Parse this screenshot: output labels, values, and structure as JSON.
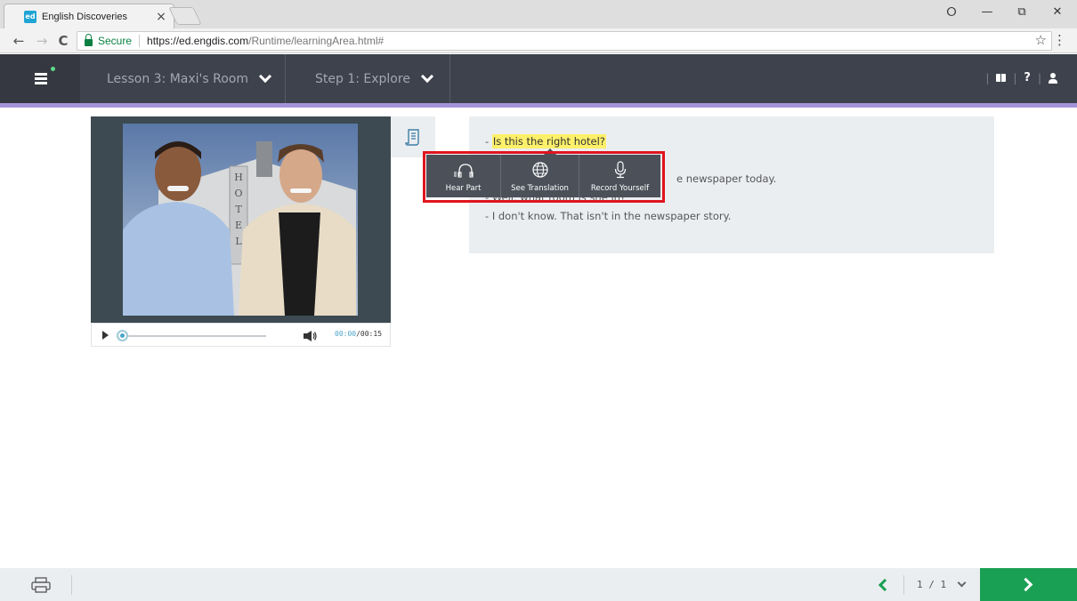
{
  "browser": {
    "tab_title": "English Discoveries",
    "tab_close": "×",
    "favicon_text": "ed",
    "secure_label": "Secure",
    "url_host": "https://ed.engdis.com",
    "url_path": "/Runtime/learningArea.html#",
    "window_controls": {
      "profile": "⭘",
      "minimize": "—",
      "restore": "⧉",
      "close": "✕"
    },
    "nav": {
      "back": "←",
      "forward": "→",
      "reload": "C"
    },
    "star": "☆",
    "menu": "⋮"
  },
  "header": {
    "lesson_label": "Lesson 3: Maxi's Room",
    "step_label": "Step 1: Explore",
    "help": "?",
    "separator": "|"
  },
  "player": {
    "current_time": "00:00",
    "time_separator": "/",
    "duration": "00:15",
    "progress": 0
  },
  "transcript": {
    "lines": [
      {
        "prefix": "- ",
        "text": "Is this the right hotel?",
        "highlighted": true
      },
      {
        "prefix": "",
        "text": "",
        "highlighted": false
      },
      {
        "prefix": "",
        "text": "e newspaper today.",
        "highlighted": false
      },
      {
        "prefix": "- ",
        "text": "Well, what room is she in?",
        "highlighted": false
      },
      {
        "prefix": "- ",
        "text": "I don't know. That isn't in the newspaper story.",
        "highlighted": false
      }
    ]
  },
  "popup": {
    "hear_part": "Hear Part",
    "see_translation": "See Translation",
    "record_yourself": "Record Yourself"
  },
  "footer": {
    "page_indicator": "1 / 1"
  },
  "colors": {
    "header_bg": "#3e424c",
    "accent_bar": "#a594d9",
    "next_green": "#1aa054",
    "highlight": "#fdf06a",
    "annotation_red": "#e0141e"
  }
}
